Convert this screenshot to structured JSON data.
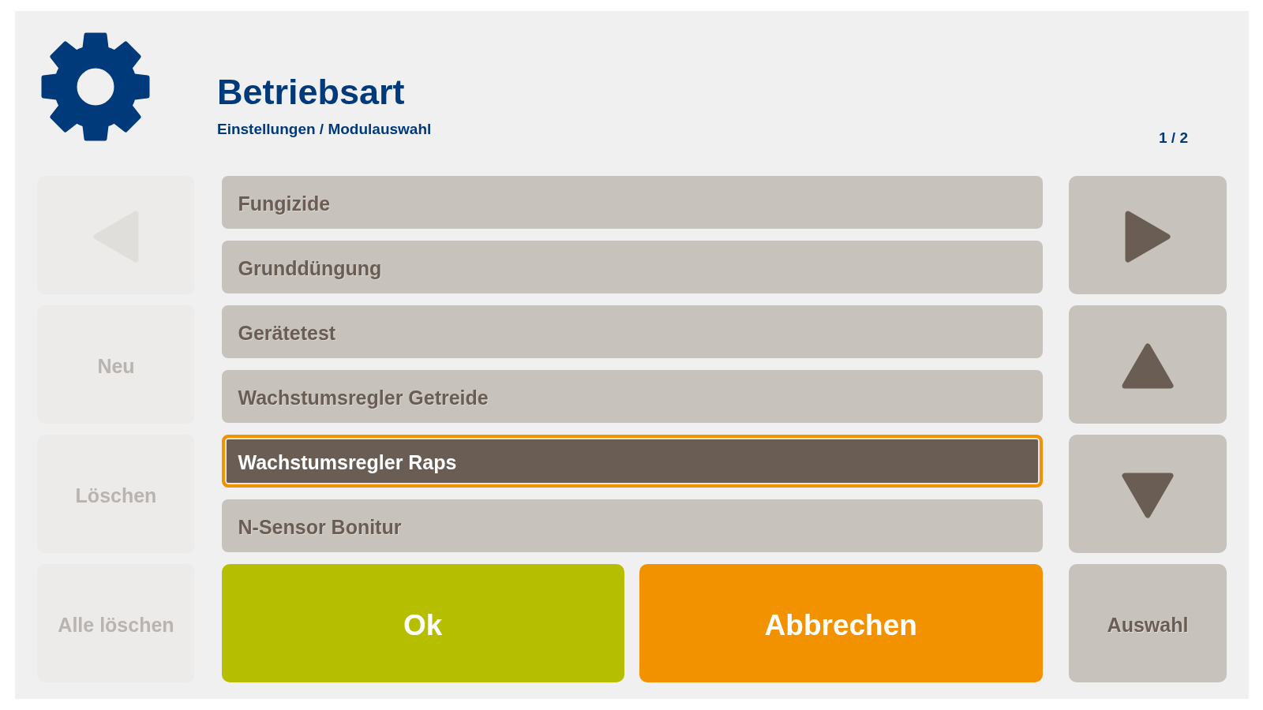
{
  "header": {
    "title": "Betriebsart",
    "breadcrumb": "Einstellungen / Modulauswahl",
    "page_indicator": "1 / 2"
  },
  "left_buttons": [
    {
      "kind": "page_back",
      "disabled": true
    },
    {
      "kind": "new",
      "label": "Neu",
      "disabled": true
    },
    {
      "kind": "delete",
      "label": "Löschen",
      "disabled": true
    },
    {
      "kind": "delete_all",
      "label": "Alle löschen",
      "disabled": true
    }
  ],
  "list": {
    "items": [
      {
        "label": "Fungizide",
        "selected": false
      },
      {
        "label": "Grunddüngung",
        "selected": false
      },
      {
        "label": "Gerätetest",
        "selected": false
      },
      {
        "label": "Wachstumsregler Getreide",
        "selected": false
      },
      {
        "label": "Wachstumsregler Raps",
        "selected": true
      },
      {
        "label": "N-Sensor Bonitur",
        "selected": false
      }
    ]
  },
  "actions": [
    {
      "kind": "ok",
      "label": "Ok"
    },
    {
      "kind": "cancel",
      "label": "Abbrechen"
    }
  ],
  "right_buttons": [
    {
      "kind": "page_forward",
      "disabled": false
    },
    {
      "kind": "scroll_up",
      "disabled": false
    },
    {
      "kind": "scroll_down",
      "disabled": false
    },
    {
      "kind": "select",
      "label": "Auswahl",
      "disabled": false
    }
  ]
}
